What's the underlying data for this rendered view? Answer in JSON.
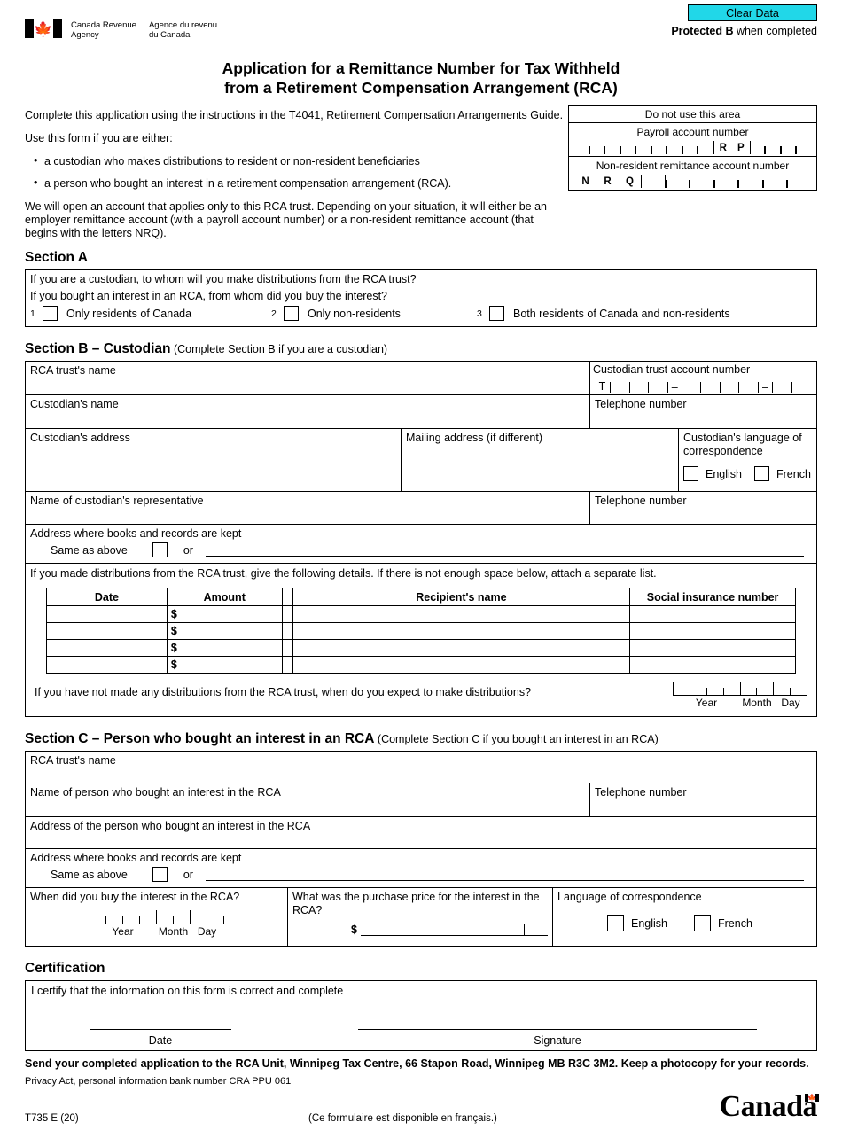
{
  "header": {
    "clear_button": "Clear Data",
    "protected_bold": "Protected B",
    "protected_rest": " when completed",
    "agency_en_line1": "Canada Revenue",
    "agency_en_line2": "Agency",
    "agency_fr_line1": "Agence du revenu",
    "agency_fr_line2": "du Canada",
    "title_line1": "Application for a Remittance Number for Tax Withheld",
    "title_line2": "from a Retirement Compensation Arrangement (RCA)"
  },
  "intro": {
    "p1": "Complete this application using the instructions in the T4041, Retirement Compensation Arrangements Guide.",
    "p2": "Use this form if you are either:",
    "bullet1": "a custodian who makes distributions to resident or non-resident beneficiaries",
    "bullet2": "a person who bought an interest in a retirement compensation arrangement (RCA).",
    "p3": "We will open an account that applies only to this RCA trust. Depending on your situation, it will either be an employer remittance account (with a payroll account number) or a non-resident remittance account (that begins with the letters NRQ)."
  },
  "do_not_use": {
    "caption": "Do not use this area",
    "payroll_label": "Payroll account number",
    "payroll_rp_r": "R",
    "payroll_rp_p": "P",
    "nonres_label": "Non-resident remittance account number",
    "nrq_n": "N",
    "nrq_r": "R",
    "nrq_q": "Q"
  },
  "section_a": {
    "heading": "Section A",
    "question1": "If you are a custodian, to whom will you make distributions from the RCA trust?",
    "question2": "If you bought an interest in an RCA, from whom did you buy the interest?",
    "options": [
      {
        "num": "1",
        "label": "Only residents of Canada"
      },
      {
        "num": "2",
        "label": "Only non-residents"
      },
      {
        "num": "3",
        "label": "Both residents of Canada and non-residents"
      }
    ]
  },
  "section_b": {
    "heading_bold": "Section B – Custodian",
    "heading_sub": " (Complete Section B if you are a custodian)",
    "rca_trust_name": "RCA trust's name",
    "custodian_trust_account_number": "Custodian trust account number",
    "trust_prefix": "T",
    "dash": "–",
    "custodian_name": "Custodian's name",
    "telephone_number": "Telephone number",
    "custodian_address": "Custodian's address",
    "mailing_address": "Mailing address (if different)",
    "language_label_line1": "Custodian's language of",
    "language_label_line2": "correspondence",
    "lang_english": "English",
    "lang_french": "French",
    "rep_name": "Name of custodian's representative",
    "rep_telephone": "Telephone number",
    "books_label": "Address where books and records are kept",
    "same_as_above": "Same as above",
    "or": "or",
    "dist_intro": "If you made distributions from the RCA trust, give the following details. If there is not enough space below, attach a separate list.",
    "table_headers": [
      "Date",
      "Amount",
      "Recipient's name",
      "Social insurance number"
    ],
    "table_rows": [
      {
        "date": "",
        "dollar": "$",
        "amount": "",
        "recipient": "",
        "sin": ""
      },
      {
        "date": "",
        "dollar": "$",
        "amount": "",
        "recipient": "",
        "sin": ""
      },
      {
        "date": "",
        "dollar": "$",
        "amount": "",
        "recipient": "",
        "sin": ""
      },
      {
        "date": "",
        "dollar": "$",
        "amount": "",
        "recipient": "",
        "sin": ""
      }
    ],
    "expect_question": "If you have not made any distributions from the RCA trust, when do you expect to make distributions?",
    "date_year": "Year",
    "date_month": "Month",
    "date_day": "Day"
  },
  "section_c": {
    "heading_bold": "Section C – Person who bought an interest in an RCA",
    "heading_sub": " (Complete Section C if you bought an interest in an RCA)",
    "rca_trust_name": "RCA trust's name",
    "buyer_name": "Name of person who bought an interest in the RCA",
    "telephone_number": "Telephone number",
    "buyer_address": "Address of the person who bought an interest in the RCA",
    "books_label": "Address where books and records are kept",
    "same_as_above": "Same as above",
    "or": "or",
    "when_bought": "When did you buy the interest in the RCA?",
    "date_year": "Year",
    "date_month": "Month",
    "date_day": "Day",
    "purchase_price_line1": "What was the purchase price for the interest in the",
    "purchase_price_line2": "RCA?",
    "dollar": "$",
    "language_label": "Language of correspondence",
    "lang_english": "English",
    "lang_french": "French"
  },
  "certification": {
    "heading": "Certification",
    "statement": "I certify that the information on this form is correct and complete",
    "date_caption": "Date",
    "signature_caption": "Signature"
  },
  "footer": {
    "send_line": "Send your completed application to the RCA Unit, Winnipeg Tax Centre, 66 Stapon Road, Winnipeg MB  R3C 3M2. Keep a photocopy for your records.",
    "privacy": "Privacy Act, personal information bank number CRA PPU 061",
    "form_code": "T735 E (20)",
    "french_note": "(Ce formulaire est disponible en français.)",
    "wordmark": "Canada"
  },
  "colors": {
    "clear_button_bg": "#21d7e8",
    "ink": "#000000",
    "paper": "#ffffff"
  }
}
